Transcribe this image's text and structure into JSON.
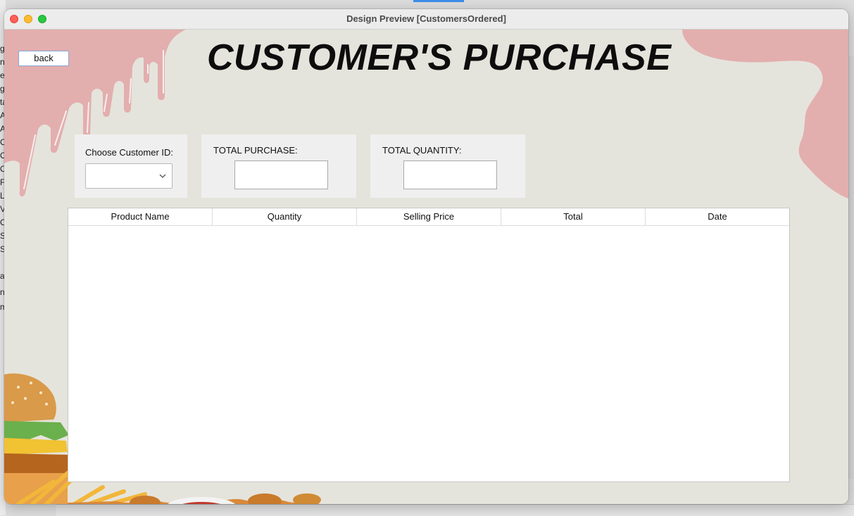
{
  "window": {
    "title": "Design Preview [CustomersOrdered]"
  },
  "toolbar": {
    "back_label": "back"
  },
  "header": {
    "title": "CUSTOMER'S PURCHASE"
  },
  "filters": {
    "customer_id_label": "Choose Customer ID:",
    "customer_id_value": "",
    "total_purchase_label": "TOTAL PURCHASE:",
    "total_purchase_value": "",
    "total_quantity_label": "TOTAL QUANTITY:",
    "total_quantity_value": ""
  },
  "table": {
    "columns": [
      "Product Name",
      "Quantity",
      "Selling Price",
      "Total",
      "Date"
    ],
    "rows": []
  },
  "background_fragments": [
    "g",
    "nt",
    "e",
    "g",
    "ta",
    "A",
    "A",
    "C",
    "C",
    "O",
    "F",
    "L",
    "V",
    "C",
    "S",
    "S",
    "a",
    "ne",
    "m"
  ],
  "colors": {
    "background": "#e5e4dc",
    "drip": "#e3aeae",
    "panel": "#efefef"
  }
}
